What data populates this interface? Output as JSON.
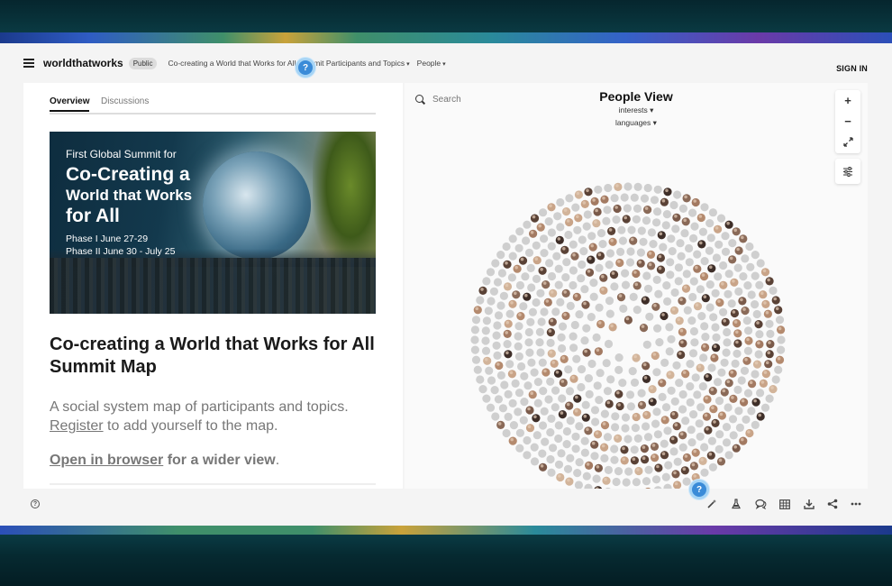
{
  "header": {
    "brand": "worldthatworks",
    "badge": "Public",
    "breadcrumbs": [
      {
        "label": "Co-creating a World that Works for All Summit Participants and Topics"
      },
      {
        "label": "People"
      }
    ],
    "sign_in": "SIGN IN",
    "help_label": "?"
  },
  "left": {
    "tabs": [
      "Overview",
      "Discussions"
    ],
    "hero": {
      "line1": "First Global Summit for",
      "line2": "Co-Creating a",
      "line3": "World that Works",
      "line4": "for All",
      "phase1": "Phase I June 27-29",
      "phase2": "Phase II  June 30 - July 25"
    },
    "title": "Co-creating a World that Works for All Summit Map",
    "desc_text": "A social system map of participants and topics.",
    "desc_link": "Register",
    "desc_tail": " to add yourself to the map.",
    "open_link": "Open in browser",
    "open_tail": " for a wider view",
    "open_period": "."
  },
  "right": {
    "search_placeholder": "Search",
    "view_title": "People View",
    "filter1": "interests",
    "filter2": "languages",
    "zoom_in": "+",
    "zoom_out": "−",
    "people_shown_with_photo_ratio": 0.3
  },
  "footer": {
    "help_label": "?",
    "help_bubble": "?",
    "tools": [
      "magic-wand-icon",
      "flask-icon",
      "comments-icon",
      "table-icon",
      "download-icon",
      "share-icon",
      "more-icon"
    ]
  },
  "colors": {
    "accent_blue": "#3a8bd8",
    "node_grey": "#cfcfcf"
  }
}
